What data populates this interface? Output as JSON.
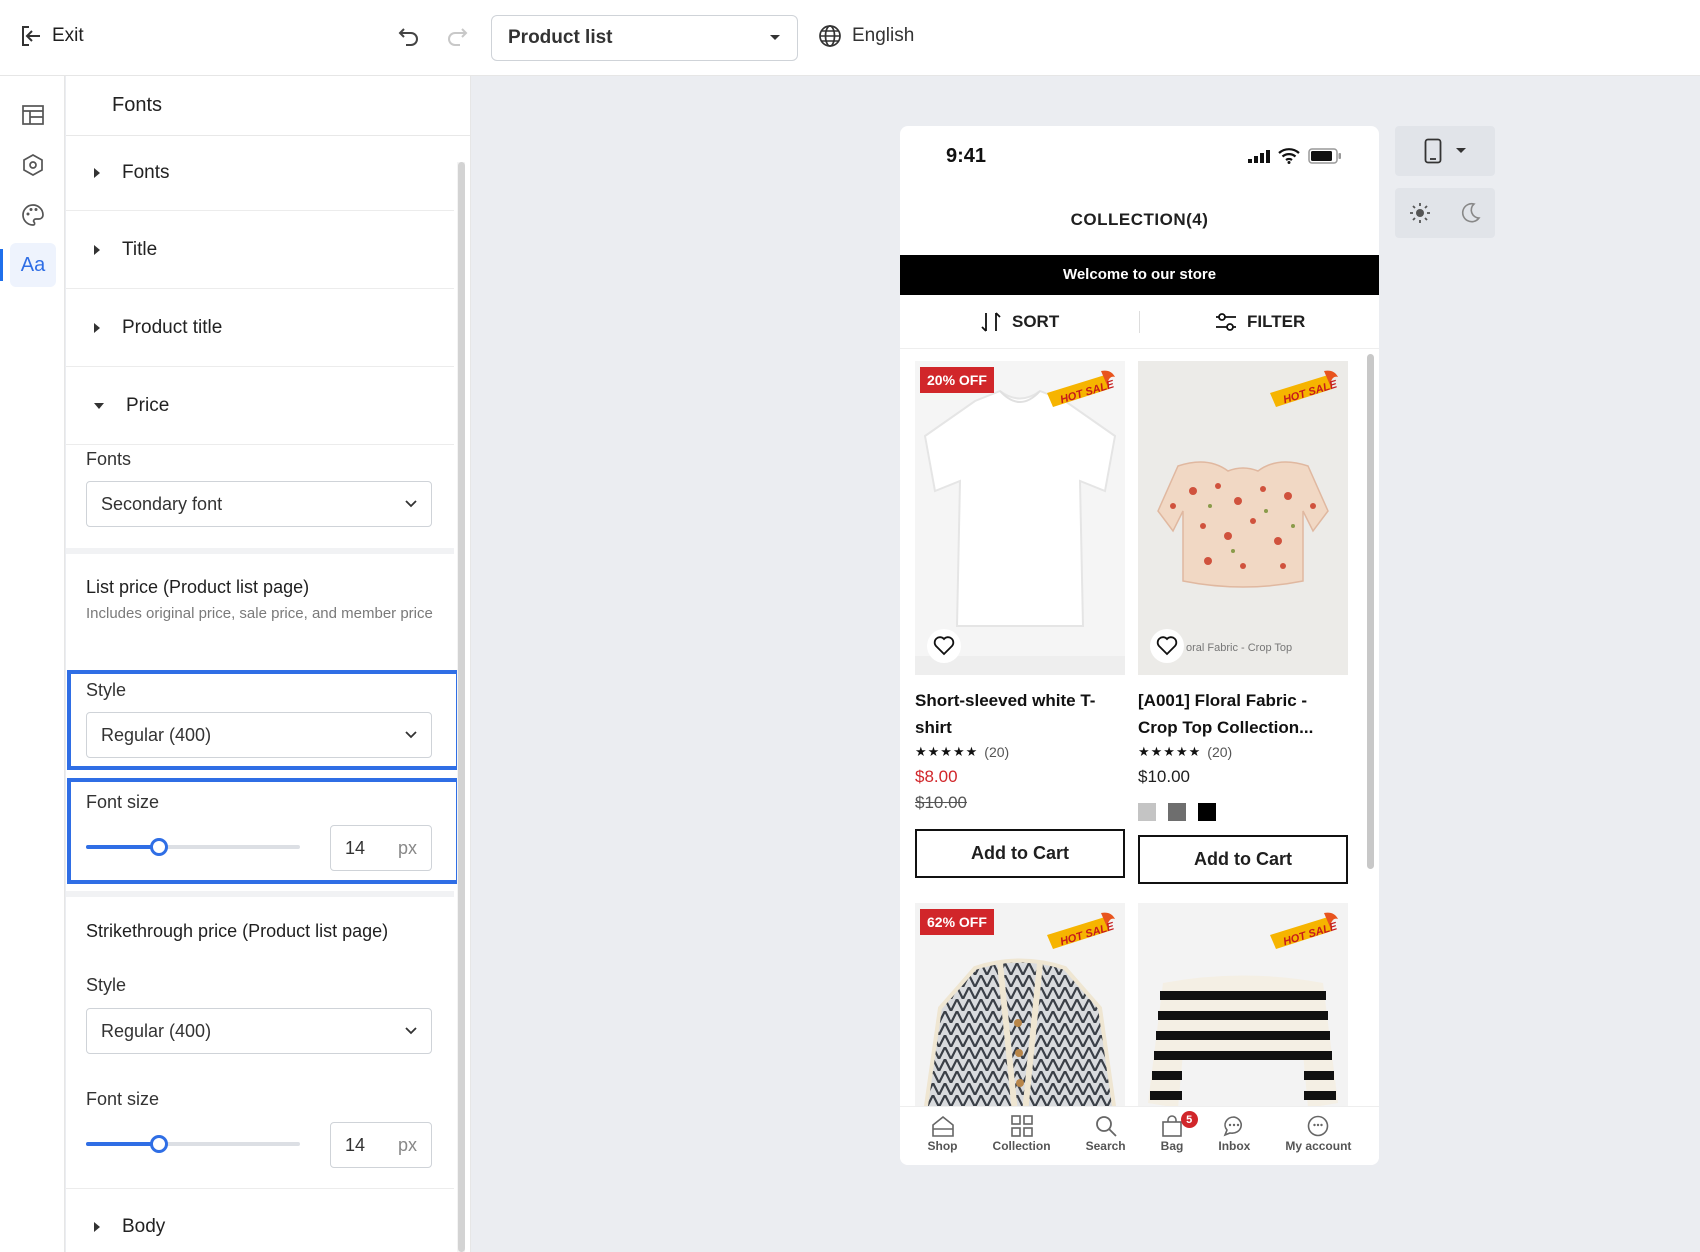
{
  "topbar": {
    "exit_label": "Exit",
    "page_select": "Product list",
    "language": "English"
  },
  "panel": {
    "title": "Fonts",
    "accordion": [
      "Fonts",
      "Title",
      "Product title",
      "Price"
    ],
    "price": {
      "fonts_label": "Fonts",
      "fonts_value": "Secondary font",
      "list_price": {
        "title": "List price (Product list page)",
        "desc": "Includes original price, sale price, and member price",
        "style_label": "Style",
        "style_value": "Regular (400)",
        "size_label": "Font size",
        "size_value": "14",
        "size_unit": "px",
        "slider_fraction": 0.34
      },
      "strike_price": {
        "title": "Strikethrough price (Product list page)",
        "style_label": "Style",
        "style_value": "Regular (400)",
        "size_label": "Font size",
        "size_value": "14",
        "size_unit": "px",
        "slider_fraction": 0.34
      }
    },
    "body_label": "Body"
  },
  "phone": {
    "time": "9:41",
    "collection_title": "COLLECTION(4)",
    "banner": "Welcome to our store",
    "sort": "SORT",
    "filter": "FILTER",
    "products": [
      {
        "badge": "20% OFF",
        "name": "Short-sleeved white T-shirt",
        "stars": "★★★★★",
        "reviews": "(20)",
        "price": "$8.00",
        "original_price": "$10.00",
        "cart": "Add to Cart"
      },
      {
        "badge": "",
        "image_caption": "oral Fabric - Crop Top",
        "name": "[A001] Floral Fabric - Crop Top Collection...",
        "stars": "★★★★★",
        "reviews": "(20)",
        "price": "$10.00",
        "swatches": [
          "#c4c4c4",
          "#6e6e6e",
          "#000000"
        ],
        "cart": "Add to Cart"
      },
      {
        "badge": "62% OFF"
      },
      {
        "badge": ""
      }
    ],
    "hot_sale": "HOT SALE",
    "tabs": [
      "Shop",
      "Collection",
      "Search",
      "Bag",
      "Inbox",
      "My account"
    ],
    "bag_count": "5"
  },
  "colors": {
    "accent": "#2f6ee5",
    "sale": "#d1262a"
  }
}
